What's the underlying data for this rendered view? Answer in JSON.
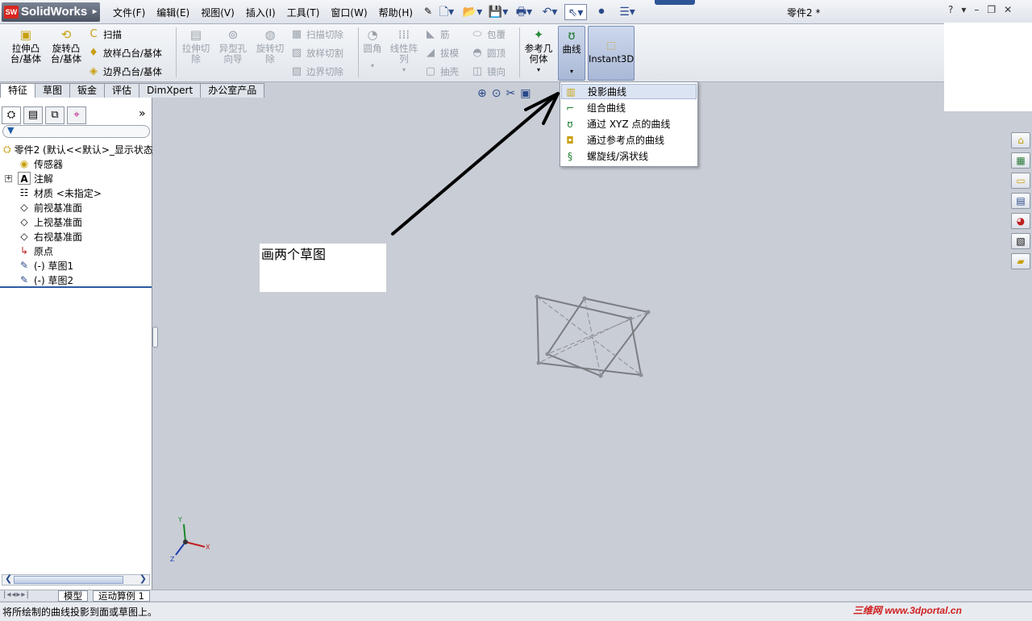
{
  "app": {
    "logo": "SolidWorks",
    "logo_badge": "SW",
    "document_title": "零件2 *"
  },
  "menu": [
    "文件(F)",
    "编辑(E)",
    "视图(V)",
    "插入(I)",
    "工具(T)",
    "窗口(W)",
    "帮助(H)"
  ],
  "window_controls": {
    "help": "?",
    "dropdown": "▾",
    "minimize": "–",
    "restore": "❐",
    "close": "✕"
  },
  "commands": {
    "extrude": "拉伸凸台/基体",
    "revolve": "旋转凸台/基体",
    "sweep": "扫描",
    "loft": "放样凸台/基体",
    "boundary": "边界凸台/基体",
    "extrude_cut": "拉伸切除",
    "hole_wizard": "异型孔向导",
    "revolve_cut": "旋转切除",
    "swept_cut": "扫描切除",
    "lofted_cut": "放样切割",
    "boundary_cut": "边界切除",
    "fillet": "圆角",
    "linear_pattern": "线性阵列",
    "rib": "筋",
    "draft": "拔模",
    "shell": "抽壳",
    "wrap": "包覆",
    "dome": "圆顶",
    "mirror": "镜向",
    "ref_geometry": "参考几何体",
    "curves": "曲线",
    "instant3d": "Instant3D"
  },
  "tabs": [
    "特征",
    "草图",
    "钣金",
    "评估",
    "DimXpert",
    "办公室产品"
  ],
  "active_tab": "特征",
  "tree": {
    "root": "零件2  (默认<<默认>_显示状态",
    "items": [
      "传感器",
      "注解",
      "材质 <未指定>",
      "前视基准面",
      "上视基准面",
      "右视基准面",
      "原点",
      "(-) 草图1",
      "(-) 草图2"
    ]
  },
  "curves_menu": {
    "items": [
      "投影曲线",
      "组合曲线",
      "通过 XYZ 点的曲线",
      "通过参考点的曲线",
      "螺旋线/涡状线"
    ],
    "highlighted_index": 0
  },
  "annotation": {
    "text": "画两个草图"
  },
  "triad": {
    "x": "X",
    "y": "Y",
    "z": "Z"
  },
  "bottom_tabs": {
    "model": "模型",
    "motion": "运动算例 1"
  },
  "status_text": "将所绘制的曲线投影到面或草图上。",
  "watermark": "三维网 www.3dportal.cn",
  "colors": {
    "accent": "#2d5aa0",
    "viewport": "#c9cdd5",
    "arrow": "#000000",
    "watermark": "#d02020"
  }
}
